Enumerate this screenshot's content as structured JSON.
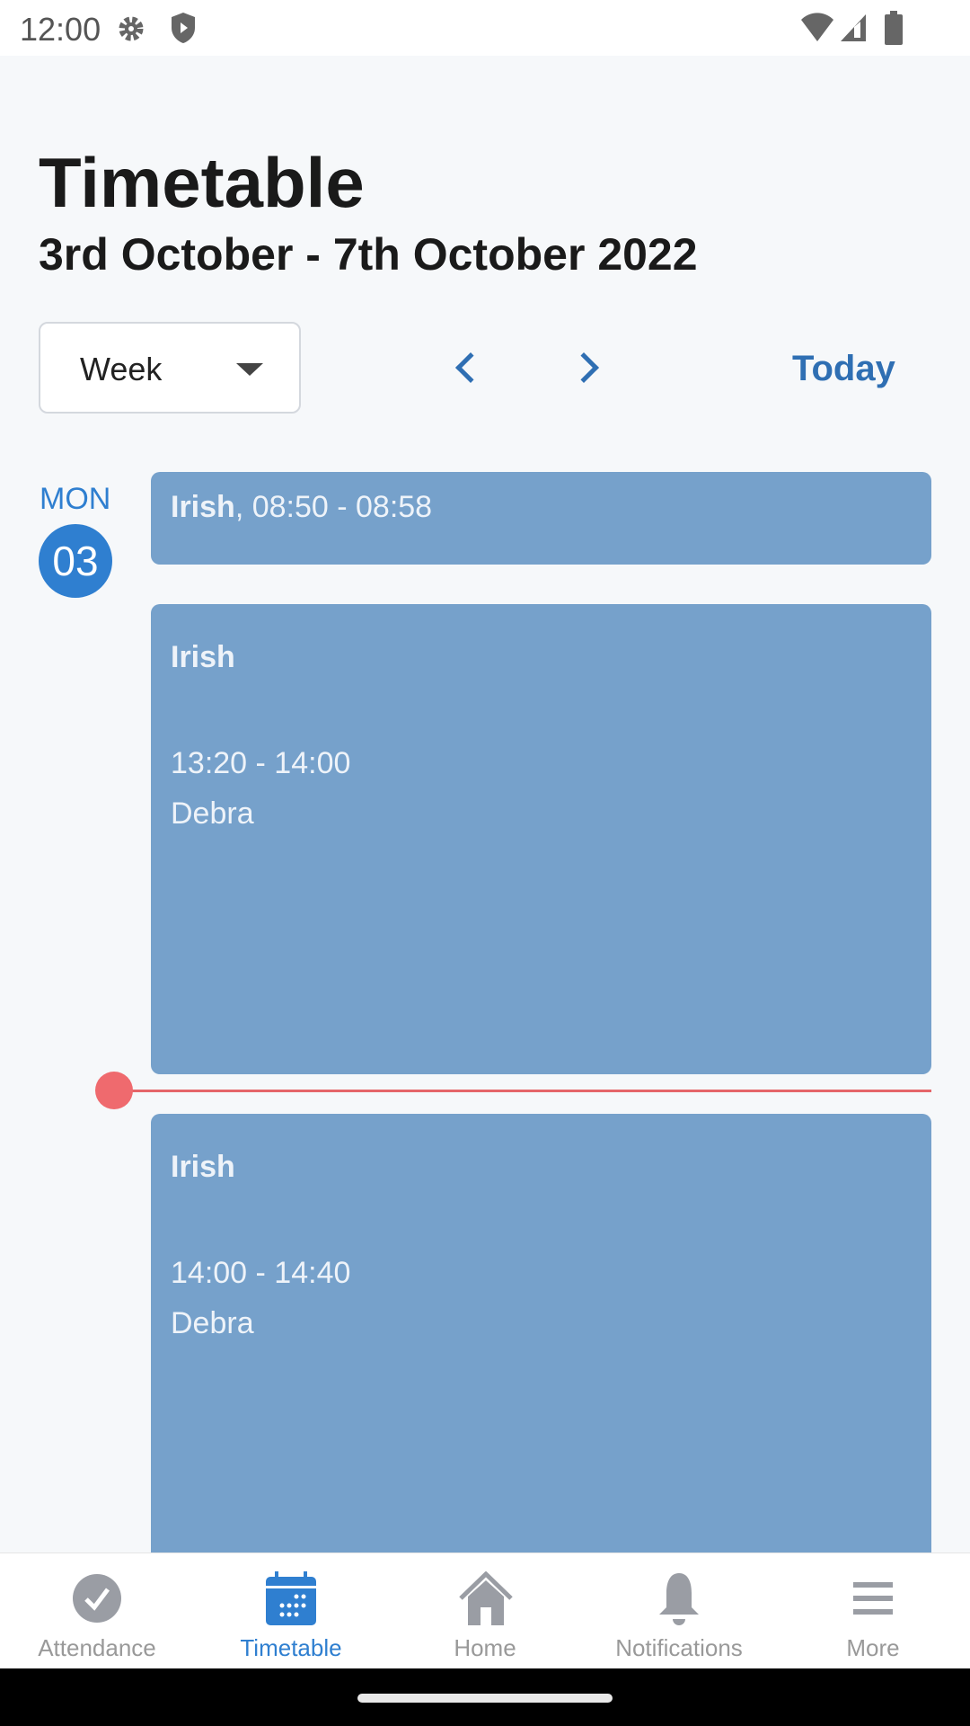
{
  "status_bar": {
    "time": "12:00",
    "icons": [
      "gear-icon",
      "shield-icon",
      "wifi-icon",
      "signal-icon",
      "battery-icon"
    ]
  },
  "header": {
    "title": "Timetable",
    "date_range": "3rd October - 7th October 2022"
  },
  "controls": {
    "view_select": "Week",
    "today_label": "Today"
  },
  "day": {
    "weekday": "MON",
    "date": "03"
  },
  "events": [
    {
      "subject": "Irish",
      "time_inline": ", 08:50 - 08:58"
    },
    {
      "subject": "Irish",
      "time": "13:20 - 14:00",
      "teacher": "Debra"
    },
    {
      "subject": "Irish",
      "time": "14:00 - 14:40",
      "teacher": "Debra"
    }
  ],
  "colors": {
    "accent": "#2f7fd0",
    "event": "#76a1cb",
    "now_line": "#e5666a"
  },
  "nav": [
    {
      "label": "Attendance",
      "active": false
    },
    {
      "label": "Timetable",
      "active": true
    },
    {
      "label": "Home",
      "active": false
    },
    {
      "label": "Notifications",
      "active": false
    },
    {
      "label": "More",
      "active": false
    }
  ]
}
